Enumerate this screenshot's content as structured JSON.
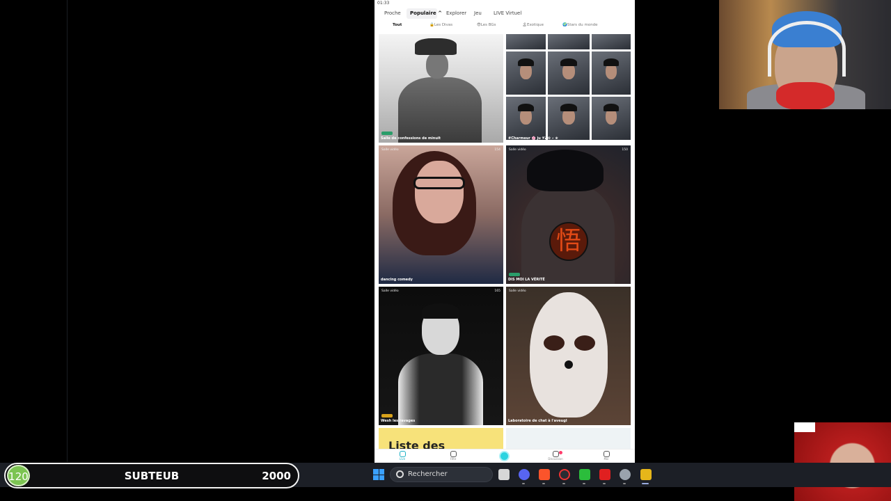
{
  "phone": {
    "status_time": "01:33",
    "tabs": [
      "Proche",
      "Populaire ^",
      "Explorer",
      "Jeu",
      "LIVE Virtuel"
    ],
    "chips": [
      "Tout",
      "Les Divas",
      "Les BGs",
      "Exotique",
      "Stars du monde"
    ],
    "cards": [
      {
        "label": "Salle de confessions de minuit",
        "tag": "",
        "count": ""
      },
      {
        "label": "#Charmeur 🌸 ju 𝓥𝓮 ✿ ⋆ ❀",
        "tag": "",
        "count": ""
      },
      {
        "label": "dancing comedy",
        "tag": "Salle vidéo",
        "count": "154"
      },
      {
        "label": "DIS MOI LA VÉRITÉ",
        "tag": "Salle vidéo",
        "count": "150"
      },
      {
        "label": "Wesh les ravages",
        "tag": "Salle vidéo",
        "count": "165"
      },
      {
        "label": "Laboratoire de chat à l'aveugl",
        "tag": "Salle vidéo",
        "count": ""
      }
    ],
    "promo_text": "Liste des",
    "kanji": "悟",
    "nav": [
      "Live",
      "Fête",
      "",
      "Discussion",
      "Moi"
    ]
  },
  "subs_bar": {
    "count": "120",
    "label": "SUBTEUB",
    "goal": "2000"
  },
  "taskbar": {
    "search_placeholder": "Rechercher"
  }
}
